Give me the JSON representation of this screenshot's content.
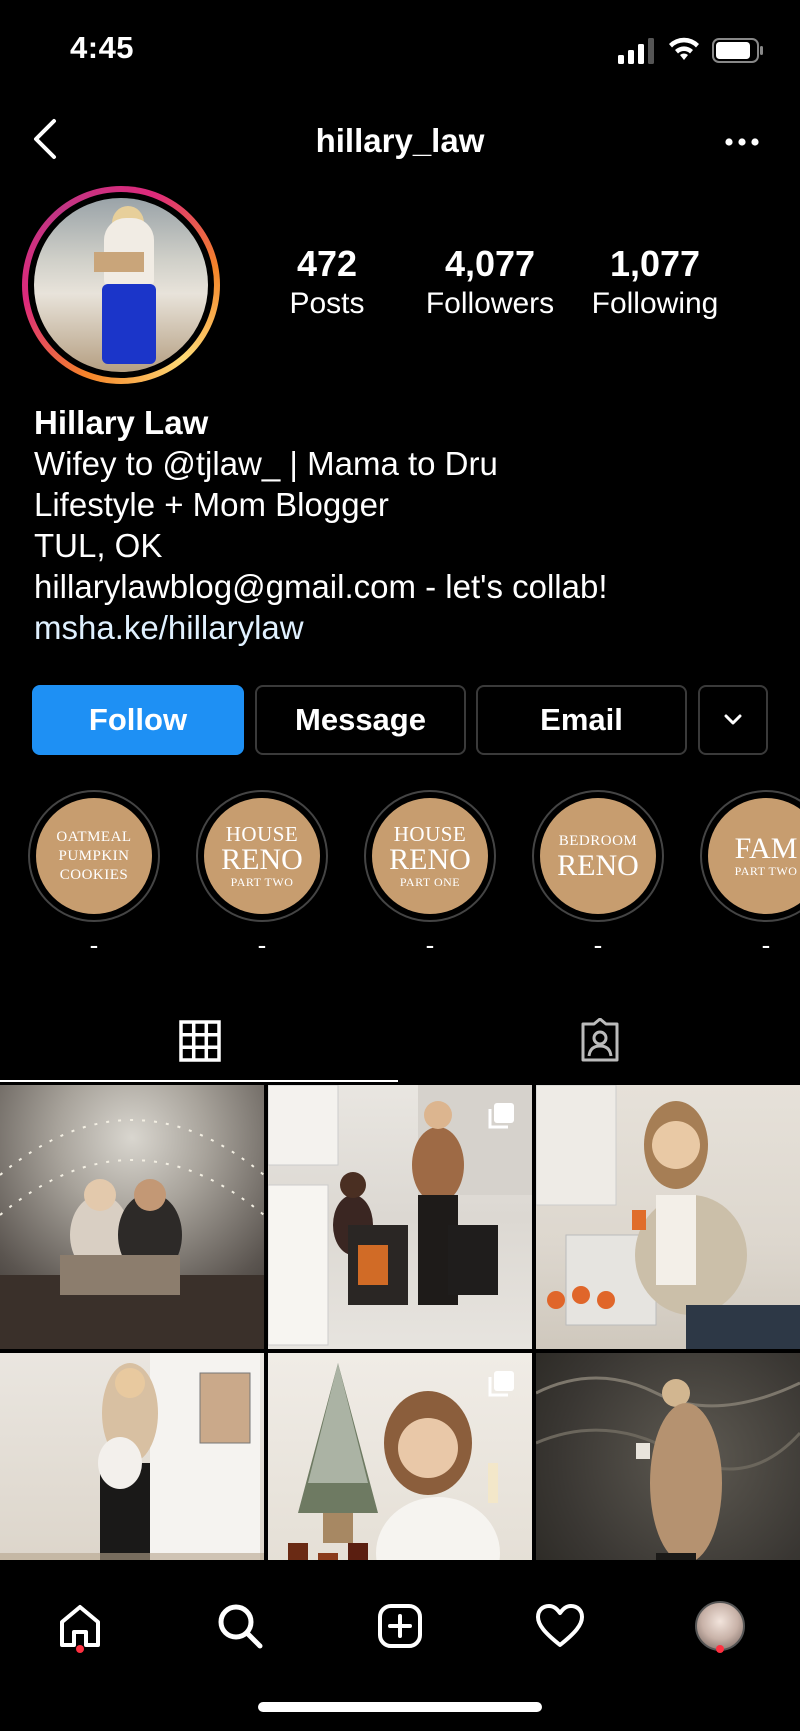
{
  "status_bar": {
    "time": "4:45"
  },
  "header": {
    "username": "hillary_law"
  },
  "profile": {
    "stats": [
      {
        "number": "472",
        "label": "Posts"
      },
      {
        "number": "4,077",
        "label": "Followers"
      },
      {
        "number": "1,077",
        "label": "Following"
      }
    ]
  },
  "bio": {
    "name": "Hillary Law",
    "lines": [
      "Wifey to @tjlaw_ | Mama to Dru",
      "Lifestyle + Mom Blogger",
      "TUL, OK",
      "hillarylawblog@gmail.com - let's collab!"
    ],
    "link": "msha.ke/hillarylaw"
  },
  "actions": {
    "follow": "Follow",
    "message": "Message",
    "email": "Email"
  },
  "highlights": [
    {
      "lines": [
        "OATMEAL",
        "PUMPKIN",
        "COOKIES"
      ],
      "label": "-"
    },
    {
      "lines": [
        "HOUSE",
        "RENO",
        "PART TWO"
      ],
      "label": "-"
    },
    {
      "lines": [
        "HOUSE",
        "RENO",
        "PART ONE"
      ],
      "label": "-"
    },
    {
      "lines": [
        "BEDROOM",
        "RENO"
      ],
      "label": "-"
    },
    {
      "lines": [
        "FAM",
        "PART TWO"
      ],
      "label": "-"
    }
  ],
  "colors": {
    "follow_button": "#1e90f4",
    "highlight_disc": "#c79d6f",
    "notification_dot": "#ff3040",
    "background": "#000000"
  },
  "icons": {
    "header": [
      "back-icon",
      "more-icon"
    ],
    "tabs": [
      "grid-icon",
      "tagged-icon"
    ],
    "nav": [
      "home-icon",
      "search-icon",
      "new-post-icon",
      "activity-icon",
      "profile-avatar"
    ]
  }
}
